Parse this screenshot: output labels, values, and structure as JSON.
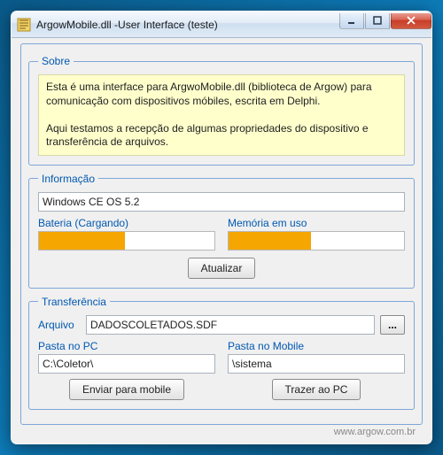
{
  "window": {
    "title": "ArgowMobile.dll -User Interface (teste)"
  },
  "about": {
    "legend": "Sobre",
    "line1": "Esta é uma interface para ArgwoMobile.dll (biblioteca de Argow) para comunicação com dispositivos móbiles, escrita em Delphi.",
    "line2": "Aqui testamos a recepção de algumas propriedades do dispositivo e transferência de arquivos."
  },
  "info": {
    "legend": "Informação",
    "os_value": "Windows CE OS 5.2",
    "battery_label": "Bateria (Cargando)",
    "battery_percent": 49,
    "memory_label": "Memória em uso",
    "memory_percent": 47,
    "refresh_label": "Atualizar"
  },
  "transfer": {
    "legend": "Transferência",
    "file_label": "Arquivo",
    "file_value": "DADOSCOLETADOS.SDF",
    "browse_label": "...",
    "pc_folder_label": "Pasta no PC",
    "pc_folder_value": "C:\\Coletor\\",
    "mobile_folder_label": "Pasta no Mobile",
    "mobile_folder_value": "\\sistema",
    "send_label": "Enviar para mobile",
    "bring_label": "Trazer ao PC"
  },
  "footer": {
    "url": "www.argow.com.br"
  }
}
